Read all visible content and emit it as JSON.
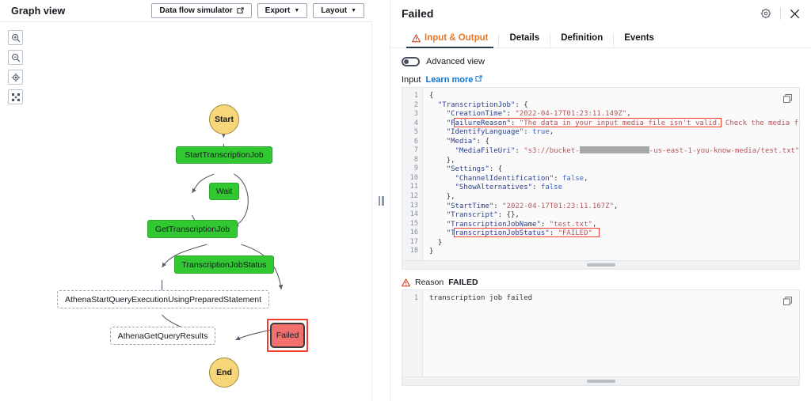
{
  "left_panel": {
    "title": "Graph view",
    "buttons": [
      {
        "label": "Data flow simulator",
        "icon": "external-link-icon"
      },
      {
        "label": "Export",
        "icon": "chevron-down-icon"
      },
      {
        "label": "Layout",
        "icon": "chevron-down-icon"
      }
    ],
    "zoom_controls": [
      {
        "name": "zoom-in-icon"
      },
      {
        "name": "zoom-out-icon"
      },
      {
        "name": "zoom-to-fit-icon"
      },
      {
        "name": "fullscreen-icon"
      }
    ],
    "graph": {
      "nodes": [
        {
          "id": "start",
          "label": "Start",
          "type": "terminal"
        },
        {
          "id": "start_transcription_job",
          "label": "StartTranscriptionJob",
          "type": "success"
        },
        {
          "id": "wait",
          "label": "Wait",
          "type": "success"
        },
        {
          "id": "get_transcription_job",
          "label": "GetTranscriptionJob",
          "type": "success"
        },
        {
          "id": "transcription_job_status",
          "label": "TranscriptionJobStatus",
          "type": "success"
        },
        {
          "id": "athena_start_query",
          "label": "AthenaStartQueryExecutionUsingPreparedStatement",
          "type": "pending"
        },
        {
          "id": "athena_get_query_results",
          "label": "AthenaGetQueryResults",
          "type": "pending"
        },
        {
          "id": "failed",
          "label": "Failed",
          "type": "failed",
          "selected": true
        },
        {
          "id": "end",
          "label": "End",
          "type": "terminal"
        }
      ],
      "colors": {
        "success": "#31c831",
        "terminal": "#f7d679",
        "failed": "#f2706e",
        "selection": "#ef3d2e",
        "pending_border": "#9aa3ad"
      }
    }
  },
  "splitter": {
    "name": "panel-resize-handle"
  },
  "right_panel": {
    "title": "Failed",
    "header_icons": [
      {
        "name": "settings-gear-icon"
      },
      {
        "name": "close-icon"
      }
    ],
    "tabs": [
      {
        "label": "Input & Output",
        "active": true,
        "warning": true
      },
      {
        "label": "Details",
        "active": false,
        "warning": false
      },
      {
        "label": "Definition",
        "active": false,
        "warning": false
      },
      {
        "label": "Events",
        "active": false,
        "warning": false
      }
    ],
    "advanced_view": {
      "label": "Advanced view",
      "enabled": false
    },
    "input_section": {
      "label": "Input",
      "learn_more": "Learn more",
      "copy_icon": "copy-icon",
      "lines": [
        {
          "n": "1",
          "text": "{"
        },
        {
          "n": "2",
          "text": "  \"TranscriptionJob\": {"
        },
        {
          "n": "3",
          "text": "    \"CreationTime\": \"2022-04-17T01:23:11.149Z\","
        },
        {
          "n": "4",
          "text": "    \"FailureReason\": \"The data in your input media file isn't valid. Check the media file and try"
        },
        {
          "n": "5",
          "text": "    \"IdentifyLanguage\": true,"
        },
        {
          "n": "6",
          "text": "    \"Media\": {"
        },
        {
          "n": "7",
          "text": "      \"MediaFileUri\": \"s3://bucket-[REDACTED]-us-east-1-you-know-media/test.txt\""
        },
        {
          "n": "8",
          "text": "    },"
        },
        {
          "n": "9",
          "text": "    \"Settings\": {"
        },
        {
          "n": "10",
          "text": "      \"ChannelIdentification\": false,"
        },
        {
          "n": "11",
          "text": "      \"ShowAlternatives\": false"
        },
        {
          "n": "12",
          "text": "    },"
        },
        {
          "n": "13",
          "text": "    \"StartTime\": \"2022-04-17T01:23:11.167Z\","
        },
        {
          "n": "14",
          "text": "    \"Transcript\": {},"
        },
        {
          "n": "15",
          "text": "    \"TranscriptionJobName\": \"test.txt\","
        },
        {
          "n": "16",
          "text": "    \"TranscriptionJobStatus\": \"FAILED\""
        },
        {
          "n": "17",
          "text": "  }"
        },
        {
          "n": "18",
          "text": "}"
        }
      ],
      "highlights": [
        {
          "line": 4,
          "note": "FailureReason highlighted in red"
        },
        {
          "line": 16,
          "note": "TranscriptionJobStatus FAILED highlighted in red"
        }
      ]
    },
    "reason_section": {
      "label": "Reason",
      "status": "FAILED",
      "copy_icon": "copy-icon",
      "lines": [
        {
          "n": "1",
          "text": "transcription job failed"
        }
      ]
    }
  }
}
